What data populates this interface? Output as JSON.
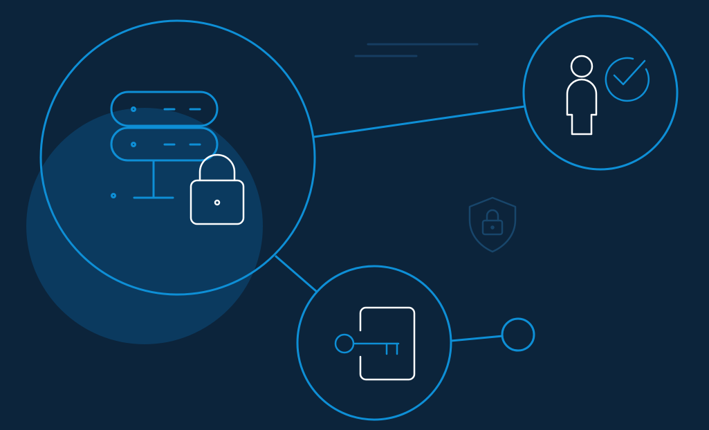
{
  "colors": {
    "background": "#0c243b",
    "accent": "#0e8fd6",
    "glow_fill": "#0b3a5f",
    "icon_white": "#ffffff",
    "faint": "#18466b"
  },
  "icons": {
    "server": "server-icon",
    "padlock": "padlock-icon",
    "user": "user-icon",
    "check": "checkmark-icon",
    "key": "key-icon",
    "door": "door-icon",
    "shield": "shield-lock-icon"
  }
}
